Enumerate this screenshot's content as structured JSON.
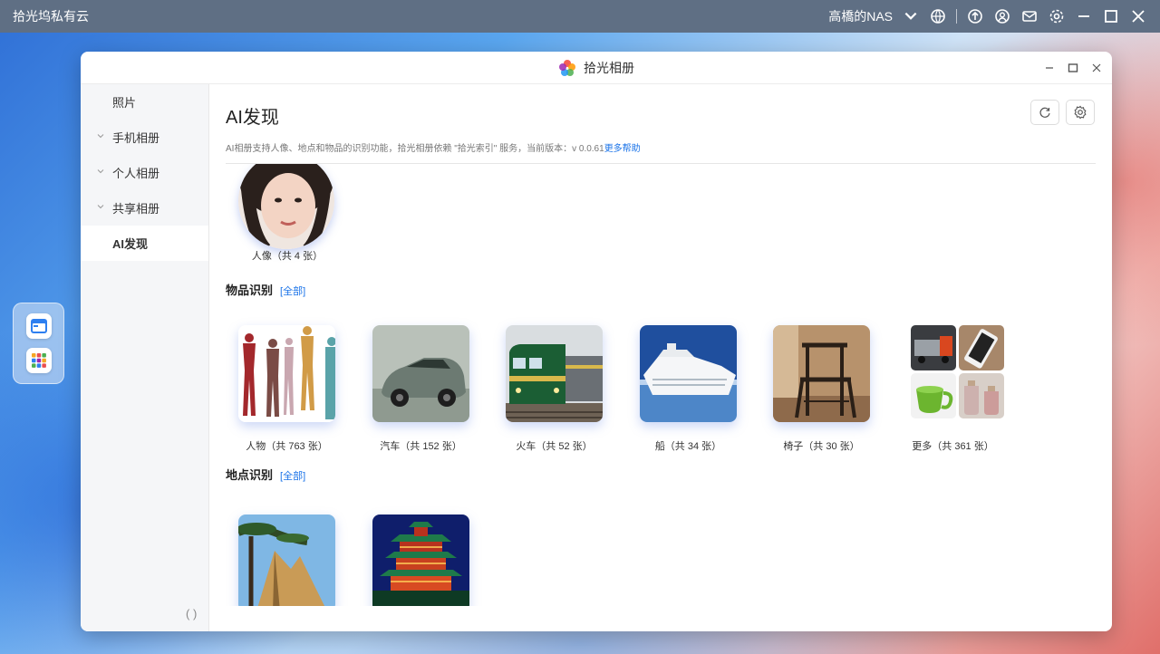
{
  "system": {
    "app_title": "拾光坞私有云",
    "nas_name": "高橋的NAS"
  },
  "window": {
    "title": "拾光相册"
  },
  "sidebar": {
    "items": [
      {
        "label": "照片"
      },
      {
        "label": "手机相册"
      },
      {
        "label": "个人相册"
      },
      {
        "label": "共享相册"
      },
      {
        "label": "AI发现"
      }
    ],
    "bottom_glyph": "( )"
  },
  "main": {
    "title": "AI发现",
    "description": "AI相册支持人像、地点和物品的识别功能，拾光相册依赖 \"拾光索引\" 服务，当前版本：v 0.0.61",
    "help_link": "更多帮助",
    "person_label": "人像（共 4 张）",
    "objects_title": "物品识别",
    "objects_all": "[全部]",
    "objects": [
      {
        "label": "人物（共 763 张）"
      },
      {
        "label": "汽车（共 152 张）"
      },
      {
        "label": "火车（共 52 张）"
      },
      {
        "label": "船（共 34 张）"
      },
      {
        "label": "椅子（共 30 张）"
      },
      {
        "label": "更多（共 361 张）"
      }
    ],
    "places_title": "地点识别",
    "places_all": "[全部]"
  },
  "colors": {
    "accent": "#1a73e8",
    "topbar": "#5f6f84"
  }
}
